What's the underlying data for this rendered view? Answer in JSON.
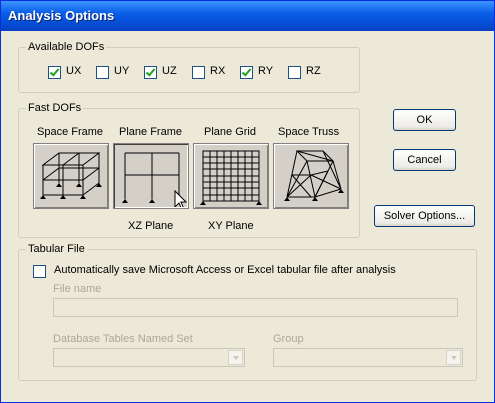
{
  "window": {
    "title": "Analysis Options"
  },
  "dofs": {
    "group_label": "Available DOFs",
    "items": [
      {
        "label": "UX",
        "checked": true
      },
      {
        "label": "UY",
        "checked": false
      },
      {
        "label": "UZ",
        "checked": true
      },
      {
        "label": "RX",
        "checked": false
      },
      {
        "label": "RY",
        "checked": true
      },
      {
        "label": "RZ",
        "checked": false
      }
    ]
  },
  "fast_dofs": {
    "group_label": "Fast DOFs",
    "options": [
      {
        "label": "Space Frame",
        "sublabel": ""
      },
      {
        "label": "Plane Frame",
        "sublabel": "XZ Plane",
        "selected": true
      },
      {
        "label": "Plane Grid",
        "sublabel": "XY Plane"
      },
      {
        "label": "Space Truss",
        "sublabel": ""
      }
    ]
  },
  "buttons": {
    "ok": "OK",
    "cancel": "Cancel",
    "solver": "Solver Options..."
  },
  "tabular": {
    "group_label": "Tabular File",
    "autosave_label": "Automatically save Microsoft Access or Excel tabular file after analysis",
    "autosave_checked": false,
    "file_name_label": "File name",
    "file_name_value": "",
    "named_set_label": "Database Tables Named Set",
    "named_set_value": "",
    "group_field_label": "Group",
    "group_value": ""
  }
}
